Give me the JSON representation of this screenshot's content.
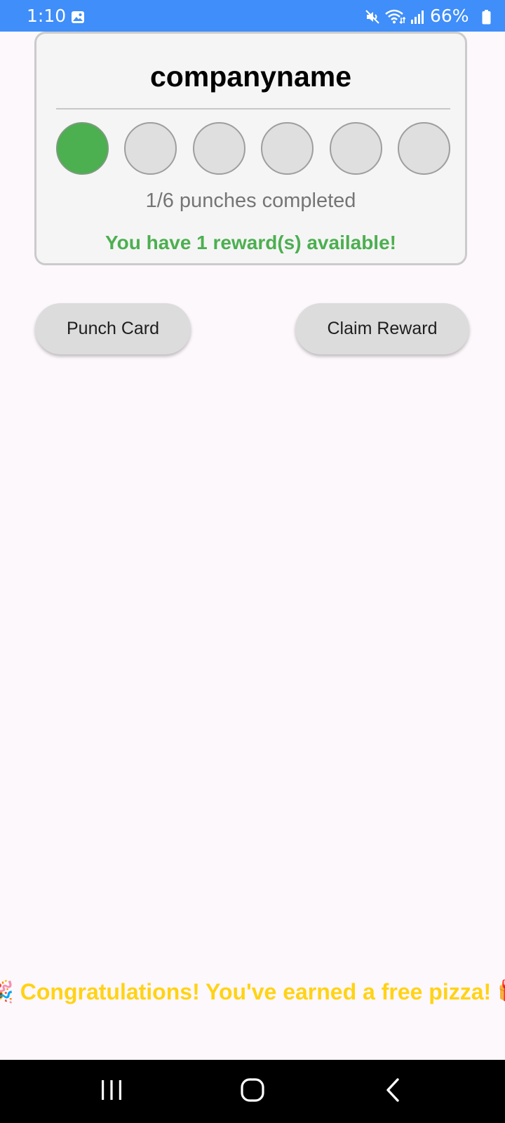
{
  "status_bar": {
    "time": "1:10",
    "battery": "66%",
    "background_color": "#3F8EF9",
    "icons": [
      "gallery-icon",
      "mute-icon",
      "wifi-icon",
      "signal-icon",
      "battery-icon"
    ]
  },
  "card": {
    "company_name": "companyname",
    "punches_total": 6,
    "punches_filled": 1,
    "progress_text": "1/6 punches completed",
    "reward_text": "You have 1 reward(s) available!",
    "filled_color": "#4CAF50",
    "empty_color": "#DFDFDF"
  },
  "buttons": {
    "punch_label": "Punch Card",
    "claim_label": "Claim Reward"
  },
  "message": {
    "congrats_text": "🎉 Congratulations! You've earned a free pizza! 🎁",
    "color": "#FFD316"
  },
  "nav_bar": {
    "icons": [
      "recent-apps-icon",
      "home-icon",
      "back-icon"
    ]
  }
}
